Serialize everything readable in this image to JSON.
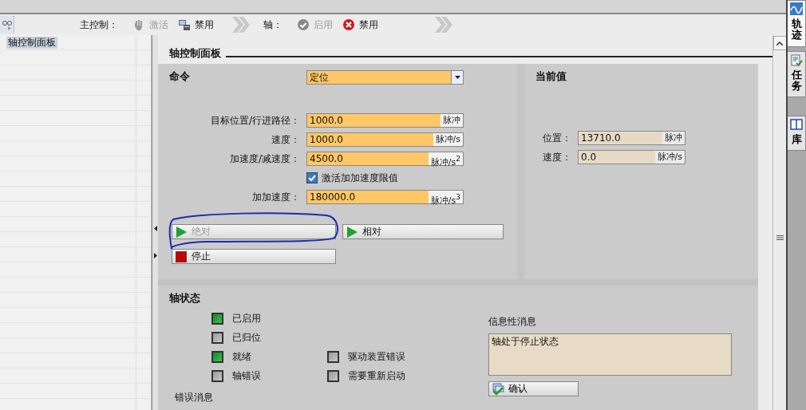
{
  "toolbar": {
    "master_label": "主控制：",
    "master_buttons": [
      {
        "label": "激活",
        "kind": "hand",
        "disabled": true
      },
      {
        "label": "禁用",
        "kind": "plug",
        "disabled": false
      }
    ],
    "axis_label": "轴：",
    "axis_buttons": [
      {
        "label": "启用",
        "kind": "check",
        "disabled": true
      },
      {
        "label": "禁用",
        "kind": "cross",
        "disabled": false
      }
    ]
  },
  "sidebar": {
    "items": [
      {
        "label": "轴控制面板",
        "selected": true
      }
    ]
  },
  "panel": {
    "title": "轴控制面板"
  },
  "command": {
    "title": "命令",
    "mode": "定位",
    "rows": [
      {
        "kind": "field",
        "label": "目标位置/行进路径：",
        "value": "1000.0",
        "unit": "脉冲"
      },
      {
        "kind": "field",
        "label": "速度：",
        "value": "1000.0",
        "unit": "脉冲/s"
      },
      {
        "kind": "field",
        "label": "加速度/减速度：",
        "value": "4500.0",
        "unit": "脉冲/s$^{2}$"
      },
      {
        "kind": "checkbox",
        "label": "激活加加速度限值",
        "checked": true
      },
      {
        "kind": "field",
        "label": "加加速度：",
        "value": "180000.0",
        "unit": "脉冲/s$^{3}$"
      }
    ],
    "buttons": [
      {
        "label": "绝对",
        "kind": "play",
        "disabled": true
      },
      {
        "label": "相对",
        "kind": "play",
        "disabled": false
      },
      {
        "label": "停止",
        "kind": "stop",
        "disabled": false
      }
    ]
  },
  "current": {
    "title": "当前值",
    "fields": [
      {
        "label": "位置：",
        "value": "13710.0",
        "unit": "脉冲"
      },
      {
        "label": "速度：",
        "value": "0.0",
        "unit": "脉冲/s"
      }
    ]
  },
  "status": {
    "title": "轴状态",
    "indicators_left": [
      {
        "label": "已启用",
        "on": true
      },
      {
        "label": "已归位",
        "on": false
      },
      {
        "label": "就绪",
        "on": true
      },
      {
        "label": "轴错误",
        "on": false
      }
    ],
    "indicators_right": [
      {
        "label": "驱动装置错误",
        "on": false
      },
      {
        "label": "需要重新启动",
        "on": false
      }
    ],
    "info_title": "信息性消息",
    "info_message": "轴处于停止状态",
    "confirm_button": "确认",
    "error_title": "错误消息"
  },
  "right_tabs": [
    {
      "label": "轨迹",
      "kind": "wave",
      "selected": true
    },
    {
      "label": "任务",
      "kind": "tasks",
      "selected": false
    },
    {
      "label": "库",
      "kind": "book",
      "selected": false
    }
  ]
}
